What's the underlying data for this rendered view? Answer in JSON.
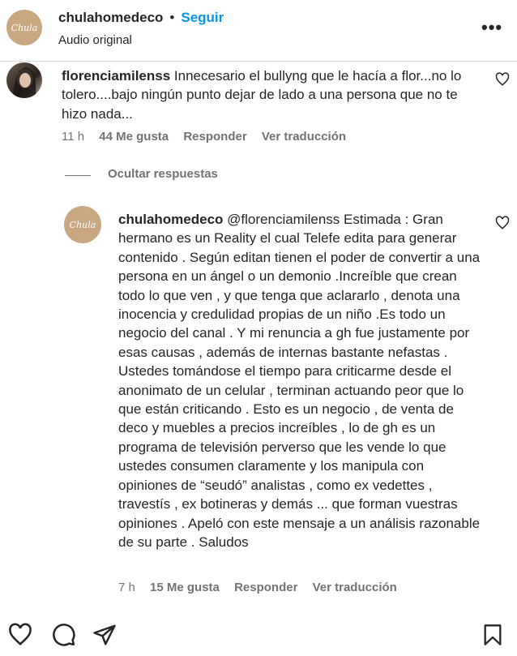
{
  "header": {
    "avatar_text": "Chula",
    "username": "chulahomedeco",
    "separator": "•",
    "follow_label": "Seguir",
    "subtitle": "Audio original",
    "more_label": "•••"
  },
  "comment": {
    "username": "florenciamilenss",
    "text": "Innecesario el bullyng que le hacía a flor...no lo tolero....bajo ningún punto dejar de lado a una persona que no te hizo nada...",
    "time": "11 h",
    "likes": "44 Me gusta",
    "reply_label": "Responder",
    "translate_label": "Ver traducción",
    "hide_replies_label": "Ocultar respuestas"
  },
  "reply": {
    "avatar_text": "Chula",
    "username": "chulahomedeco",
    "mention": "@florenciamilenss",
    "text": " Estimada : Gran hermano es un Reality el cual Telefe edita para generar contenido . Según editan tienen el poder de convertir a una persona en un ángel o un demonio .Increíble que crean todo lo que ven , y que tenga que aclararlo , denota una inocencia y credulidad propias de un niño .Es todo un negocio del canal . Y mi renuncia a gh fue justamente por esas causas , además de internas bastante nefastas . Ustedes tomándose el tiempo para criticarme desde el anonimato de un celular , terminan actuando peor que lo que están criticando . Esto es un negocio , de venta de deco y muebles a precios increíbles , lo de gh es un programa de televisión perverso que les vende lo que ustedes consumen claramente y los manipula con opiniones de “seudó” analistas , como ex vedettes , travestís , ex botineras y demás ... que forman vuestras opiniones . Apeló con este mensaje a un análisis razonable de su parte . Saludos",
    "time": "7 h",
    "likes": "15 Me gusta",
    "reply_label": "Responder",
    "translate_label": "Ver traducción"
  },
  "actions": {
    "like_icon": "heart-icon",
    "comment_icon": "comment-icon",
    "share_icon": "share-icon",
    "save_icon": "bookmark-icon"
  }
}
